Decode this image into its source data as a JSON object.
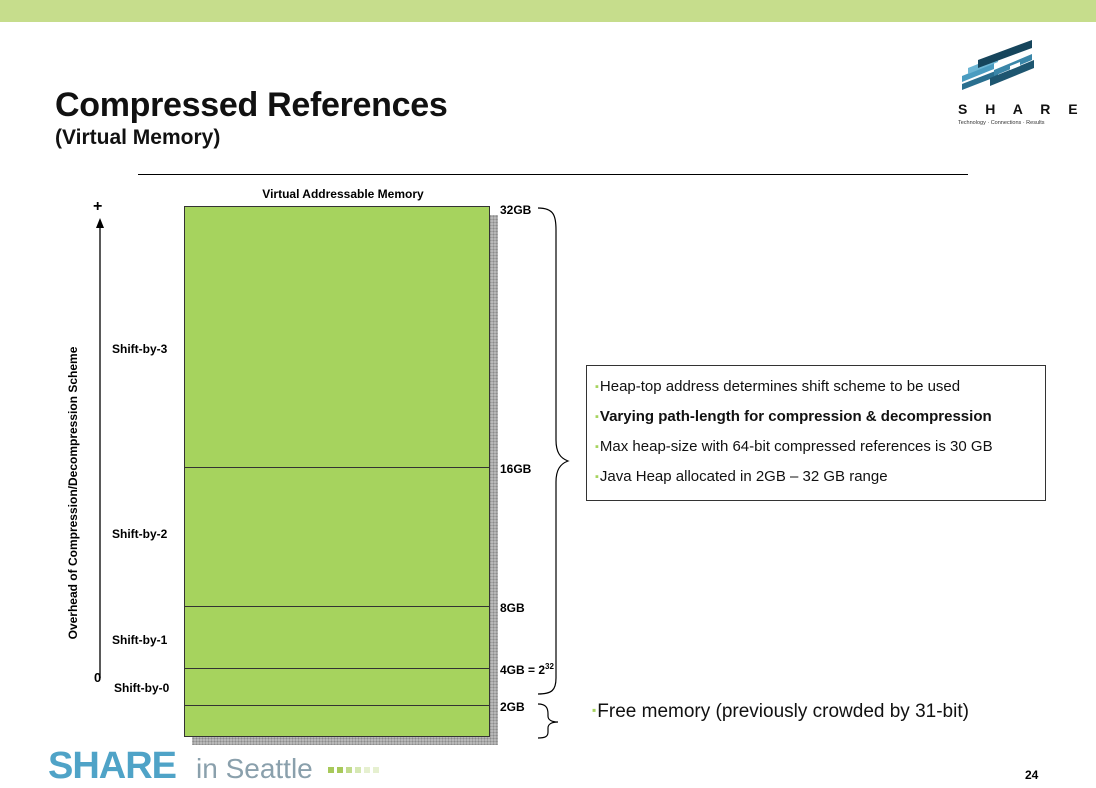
{
  "slide": {
    "title": "Compressed References",
    "subtitle": "(Virtual Memory)",
    "page_number": "24"
  },
  "logo": {
    "word": "S H A R E",
    "tagline": "Technology · Connections · Results"
  },
  "diagram": {
    "header": "Virtual Addressable Memory",
    "axis_label": "Overhead of Compression/Decompression Scheme",
    "axis_top": "+",
    "axis_bottom": "0",
    "boundaries": {
      "gb32": "32GB",
      "gb16": "16GB",
      "gb8": "8GB",
      "gb4": "4GB = 2",
      "gb4_exp": "32",
      "gb2": "2GB"
    },
    "shifts": {
      "s3": "Shift-by-3",
      "s2": "Shift-by-2",
      "s1": "Shift-by-1",
      "s0": "Shift-by-0"
    }
  },
  "info": {
    "bullet": "▪",
    "items": [
      "Heap-top address determines shift scheme to be used",
      "Varying path-length for compression & decompression",
      "Max heap-size with 64-bit compressed references is 30 GB",
      "Java Heap allocated in 2GB – 32 GB range"
    ]
  },
  "free_memory": "Free memory (previously crowded by 31-bit)",
  "footer": {
    "share": "SHARE",
    "location": "in Seattle"
  },
  "colors": {
    "memory_fill": "#a6d35e",
    "top_bar": "#c6dd8c",
    "footer_blue": "#4fa3c7"
  }
}
